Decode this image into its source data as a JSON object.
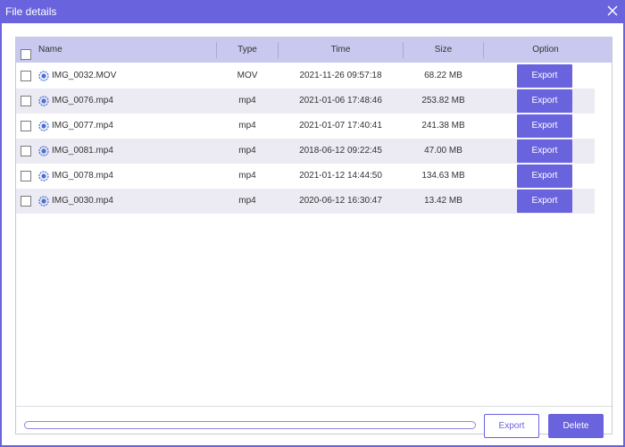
{
  "window": {
    "title": "File details",
    "accent_color": "#6a63de"
  },
  "table": {
    "columns": {
      "name": "Name",
      "type": "Type",
      "time": "Time",
      "size": "Size",
      "option": "Option"
    },
    "rows": [
      {
        "name": "IMG_0032.MOV",
        "type": "MOV",
        "time": "2021-11-26 09:57:18",
        "size": "68.22 MB",
        "action": "Export",
        "icon": "video-file-icon"
      },
      {
        "name": "IMG_0076.mp4",
        "type": "mp4",
        "time": "2021-01-06 17:48:46",
        "size": "253.82 MB",
        "action": "Export",
        "icon": "video-file-icon"
      },
      {
        "name": "IMG_0077.mp4",
        "type": "mp4",
        "time": "2021-01-07 17:40:41",
        "size": "241.38 MB",
        "action": "Export",
        "icon": "video-file-icon"
      },
      {
        "name": "IMG_0081.mp4",
        "type": "mp4",
        "time": "2018-06-12 09:22:45",
        "size": "47.00 MB",
        "action": "Export",
        "icon": "video-file-icon"
      },
      {
        "name": "IMG_0078.mp4",
        "type": "mp4",
        "time": "2021-01-12 14:44:50",
        "size": "134.63 MB",
        "action": "Export",
        "icon": "video-file-icon"
      },
      {
        "name": "IMG_0030.mp4",
        "type": "mp4",
        "time": "2020-06-12 16:30:47",
        "size": "13.42 MB",
        "action": "Export",
        "icon": "video-file-icon"
      }
    ]
  },
  "footer": {
    "progress": 0,
    "export_label": "Export",
    "delete_label": "Delete"
  }
}
